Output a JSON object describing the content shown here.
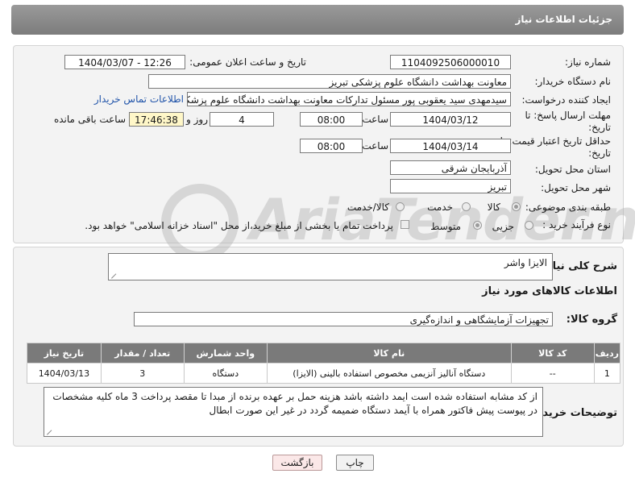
{
  "header": {
    "title": "جزئیات اطلاعات نیاز"
  },
  "form": {
    "need_number_label": "شماره نیاز:",
    "need_number": "1104092506000010",
    "announce_label": "تاریخ و ساعت اعلان عمومی:",
    "announce_value": "1404/03/07 - 12:26",
    "buyer_org_label": "نام دستگاه خریدار:",
    "buyer_org": "معاونت بهداشت دانشگاه علوم پزشکی تبریز",
    "creator_label": "ایجاد کننده درخواست:",
    "creator": "سیدمهدی سید یعقوبی پور مسئول تدارکات معاونت بهداشت دانشگاه علوم پزشکی تبریز",
    "buyer_contact_link": "اطلاعات تماس خریدار",
    "reply_deadline_label": "مهلت ارسال پاسخ: تا تاریخ:",
    "reply_date": "1404/03/12",
    "time_label": "ساعت",
    "reply_time": "08:00",
    "days_value": "4",
    "days_label": "روز و",
    "remaining_time": "17:46:38",
    "remaining_label": "ساعت باقی مانده",
    "price_validity_label": "حداقل تاریخ اعتبار قیمت: تا تاریخ:",
    "price_date": "1404/03/14",
    "price_time": "08:00",
    "province_label": "استان محل تحویل:",
    "province": "آذربایجان شرقی",
    "city_label": "شهر محل تحویل:",
    "city": "تبریز",
    "category_label": "طبقه بندی موضوعی:",
    "category_options": [
      "کالا",
      "خدمت",
      "کالا/خدمت"
    ],
    "process_label": "نوع فرآیند خرید :",
    "process_options": [
      "جزیی",
      "متوسط"
    ],
    "payment_note": "پرداخت تمام یا بخشی از مبلغ خرید،از محل \"اسناد خزانه اسلامی\" خواهد بود."
  },
  "details": {
    "summary_label": "شرح کلی نیاز:",
    "summary": "الایزا واشر",
    "goods_info_title": "اطلاعات کالاهای مورد نیاز",
    "goods_group_label": "گروه کالا:",
    "goods_group": "تجهیزات آزمایشگاهی و اندازه‌گیری",
    "table": {
      "headers": [
        "ردیف",
        "کد کالا",
        "نام کالا",
        "واحد شمارش",
        "تعداد / مقدار",
        "تاریخ نیاز"
      ],
      "rows": [
        [
          "1",
          "--",
          "دستگاه آنالیز آنزیمی مخصوص استفاده بالینی (الایزا)",
          "دستگاه",
          "3",
          "1404/03/13"
        ]
      ]
    },
    "buyer_notes_label": "توضیحات خریدار:",
    "buyer_notes": "از کد مشابه استفاده شده است ایمد داشته باشد هزینه حمل بر عهده برنده از مبدا تا مقصد پرداخت 3 ماه کلیه مشخصات در پیوست پیش فاکتور همراه با آیمد دستگاه ضمیمه گردد در غیر این صورت ابطال"
  },
  "watermark": {
    "text": "AriaTender.neT"
  },
  "buttons": {
    "print": "چاپ",
    "back": "بازگشت"
  }
}
